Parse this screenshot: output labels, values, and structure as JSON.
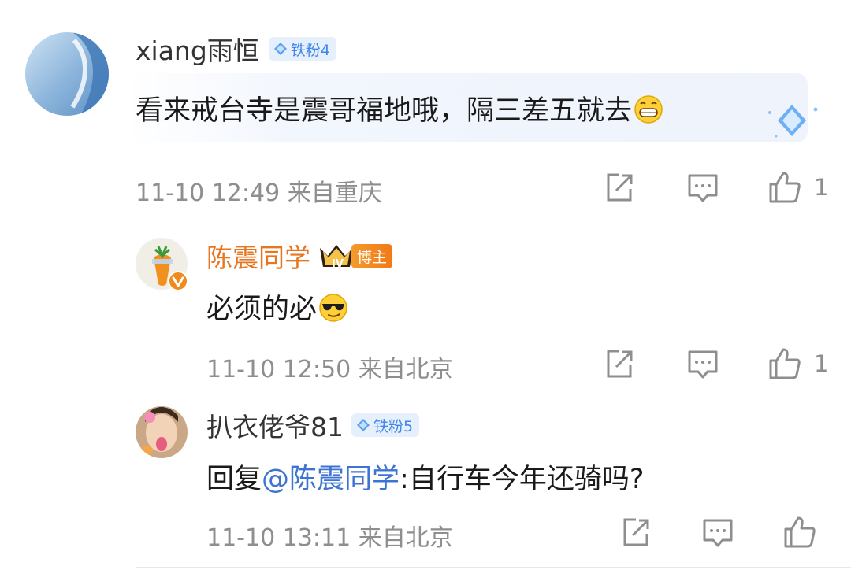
{
  "comments": [
    {
      "username": "xiang雨恒",
      "fan_badge": "铁粉4",
      "text": "看来戒台寺是震哥福地哦，隔三差五就去",
      "emoji": "grin-emoji",
      "date": "11-10 12:49",
      "location": "来自重庆",
      "likes": "1"
    },
    {
      "username": "陈震同学",
      "rank_badge": "IV",
      "role_badge": "博主",
      "text": "必须的必",
      "emoji": "sunglasses-emoji",
      "date": "11-10 12:50",
      "location": "来自北京",
      "likes": "1"
    },
    {
      "username": "扒衣佬爷81",
      "fan_badge": "铁粉5",
      "reply_prefix": "回复",
      "mention": "@陈震同学",
      "text": ":自行车今年还骑吗?",
      "date": "11-10 13:11",
      "location": "来自北京",
      "likes": ""
    }
  ],
  "colors": {
    "accent_orange": "#e8761f",
    "mention_blue": "#3d74d4",
    "badge_bg": "#e6f0fd",
    "badge_text": "#3f86e8",
    "meta_gray": "#8e8e8e"
  },
  "icons": [
    "share-icon",
    "comment-icon",
    "like-icon",
    "verified-icon",
    "crown-icon",
    "diamond-decoration-icon"
  ]
}
